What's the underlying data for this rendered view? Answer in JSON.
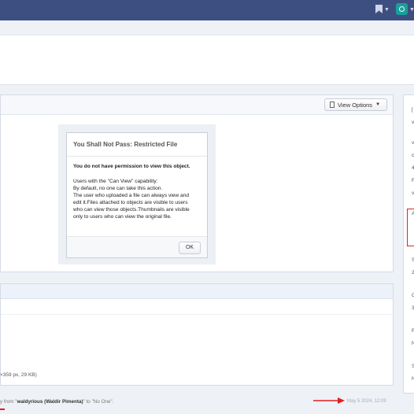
{
  "topbar": {
    "bookmark_icon": "bookmark-icon",
    "avatar_icon": "user-avatar"
  },
  "main": {
    "view_options_label": "View Options",
    "restricted_dialog": {
      "title": "You Shall Not Pass: Restricted File",
      "message": "You do not have permission to view this object.",
      "capability_line": "Users with the \"Can View\" capability:",
      "detail_lines": [
        "By default, no one can take this action.",
        "The user who uploaded a file can always view and",
        "edit it.Files attached to objects are visible to users",
        "who can view those objects.Thumbnails are visible",
        "only to users who can view the original file."
      ],
      "ok_label": "OK"
    }
  },
  "info": {
    "filesize_text": "×359 px, 29 KB)"
  },
  "transaction": {
    "prefix": "y from \"",
    "user": "waldyrious (Waldir Pimenta)",
    "suffix": "\" to \"No One\".",
    "timestamp": "May 5 2024, 12:09"
  },
  "side": {
    "chars": [
      "[",
      "v",
      "v",
      "c",
      "4",
      "F",
      "v",
      "A",
      "S",
      "2",
      "C",
      "3",
      "R",
      "N",
      "S",
      "N"
    ]
  },
  "colors": {
    "topbar": "#3d4f80",
    "annotation_red": "#e02020"
  }
}
